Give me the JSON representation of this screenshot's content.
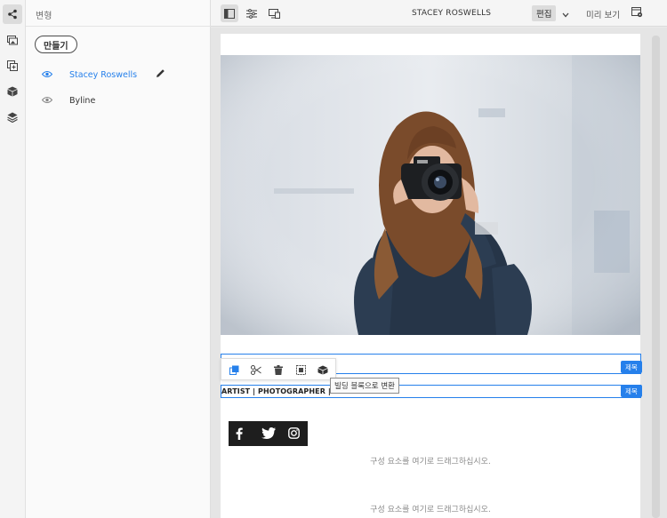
{
  "rail": {
    "items": [
      {
        "icon": "share-nodes-icon",
        "active": true
      },
      {
        "icon": "assets-icon",
        "active": false
      },
      {
        "icon": "components-icon",
        "active": false
      },
      {
        "icon": "box-icon",
        "active": false
      },
      {
        "icon": "layers-icon",
        "active": false
      }
    ]
  },
  "panel": {
    "title": "변형",
    "create_label": "만들기",
    "variations": [
      {
        "label": "Stacey Roswells",
        "selected": true
      },
      {
        "label": "Byline",
        "selected": false
      }
    ]
  },
  "topbar": {
    "page_title": "STACEY ROSWELLS",
    "mode_label": "편집",
    "preview_label": "미리 보기"
  },
  "canvas": {
    "title_tag_1": "제목",
    "title_tag_2": "제목",
    "tooltip": "빌딩 블록으로 변환",
    "byline": "ARTIST | PHOTOGRAPHER | TRAVE",
    "drop_hint_1": "구성 요소를 여기로 드래그하십시오.",
    "drop_hint_2": "구성 요소를 여기로 드래그하십시오."
  },
  "colors": {
    "accent": "#2680eb",
    "social_bg": "#1e1e1e"
  }
}
